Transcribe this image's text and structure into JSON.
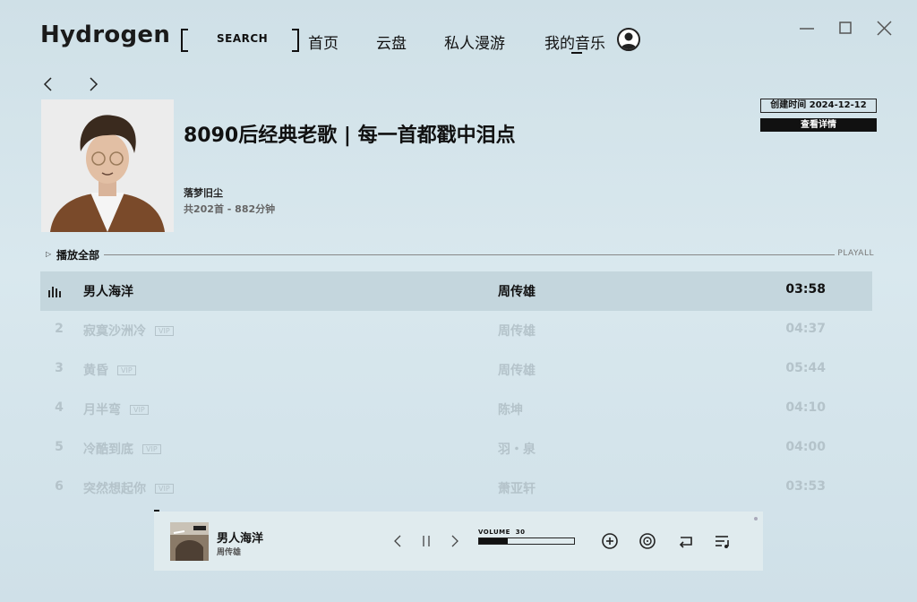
{
  "app": {
    "name": "Hydrogen"
  },
  "search": {
    "label": "SEARCH"
  },
  "nav": [
    {
      "label": "首页"
    },
    {
      "label": "云盘"
    },
    {
      "label": "私人漫游"
    },
    {
      "label": "我的音乐"
    }
  ],
  "playlist": {
    "title": "8090后经典老歌 | 每一首都戳中泪点",
    "creator": "落梦旧尘",
    "stats": "共202首 - 882分钟",
    "created": "创建时间 2024-12-12",
    "detail_button": "查看详情",
    "play_all": "播放全部",
    "play_all_en": "PLAYALL"
  },
  "tracks": [
    {
      "no": "",
      "name": "男人海洋",
      "vip": "",
      "artist": "周传雄",
      "duration": "03:58"
    },
    {
      "no": "2",
      "name": "寂寞沙洲冷",
      "vip": "VIP",
      "artist": "周传雄",
      "duration": "04:37"
    },
    {
      "no": "3",
      "name": "黄昏",
      "vip": "VIP",
      "artist": "周传雄",
      "duration": "05:44"
    },
    {
      "no": "4",
      "name": "月半弯",
      "vip": "VIP",
      "artist": "陈坤",
      "duration": "04:10"
    },
    {
      "no": "5",
      "name": "冷酷到底",
      "vip": "VIP",
      "artist": "羽・泉",
      "duration": "04:00"
    },
    {
      "no": "6",
      "name": "突然想起你",
      "vip": "VIP",
      "artist": "萧亚轩",
      "duration": "03:53"
    }
  ],
  "player": {
    "title": "男人海洋",
    "artist": "周传雄",
    "volume_label": "VOLUME",
    "volume": "30",
    "volume_fraction": 0.3
  },
  "icons": {
    "back": "chevron-left-icon",
    "forward": "chevron-right-icon",
    "minimize": "minimize-icon",
    "maximize": "maximize-icon",
    "close": "close-icon",
    "user": "user-avatar-icon",
    "playing": "equalizer-icon",
    "prev": "previous-icon",
    "pause": "pause-icon",
    "next": "next-icon",
    "add": "add-icon",
    "disc": "disc-icon",
    "repeat": "repeat-icon",
    "queue": "playlist-icon"
  }
}
